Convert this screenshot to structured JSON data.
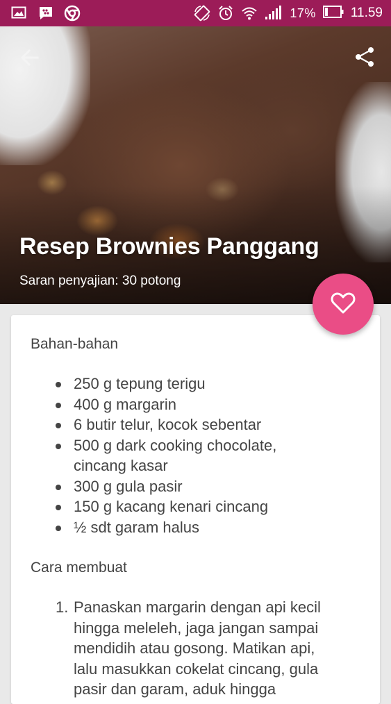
{
  "status_bar": {
    "battery_percent": "17%",
    "time": "11.59",
    "left_icons": [
      "gallery-icon",
      "bbm-icon",
      "chrome-icon"
    ],
    "right_icons": [
      "screen-rotate-icon",
      "alarm-icon",
      "wifi-icon",
      "signal-icon",
      "battery-icon"
    ],
    "color": "#9c1c58"
  },
  "hero": {
    "title": "Resep Brownies Panggang",
    "subtitle": "Saran penyajian: 30 potong",
    "back_icon": "back-arrow-icon",
    "share_icon": "share-icon"
  },
  "fab": {
    "icon": "heart-icon",
    "color": "#ea4d86"
  },
  "ingredients": {
    "title": "Bahan-bahan",
    "items": [
      [
        "250 g tepung terigu"
      ],
      [
        "400 g margarin"
      ],
      [
        "6 butir telur, kocok sebentar"
      ],
      [
        "500 g dark cooking chocolate,",
        "cincang kasar"
      ],
      [
        "300 g gula pasir"
      ],
      [
        "150 g kacang kenari cincang"
      ],
      [
        "½ sdt garam halus"
      ]
    ]
  },
  "method": {
    "title": "Cara membuat",
    "steps": [
      {
        "number": "1.",
        "lines": [
          "Panaskan margarin dengan api kecil",
          "hingga meleleh, jaga jangan sampai",
          "mendidih atau gosong. Matikan api,",
          "lalu masukkan cokelat cincang, gula",
          "pasir dan garam, aduk hingga"
        ]
      }
    ]
  }
}
